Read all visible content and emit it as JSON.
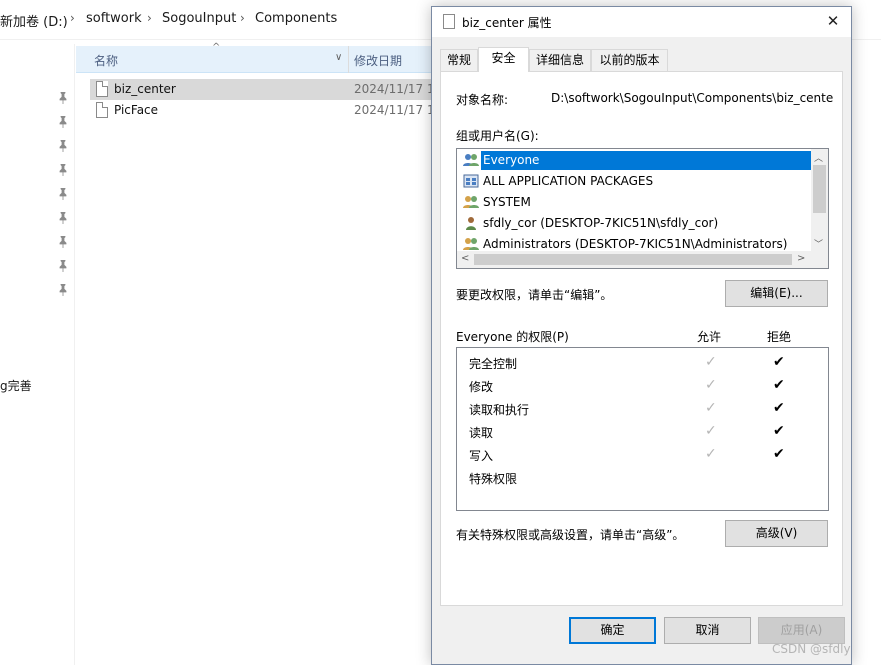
{
  "explorer": {
    "breadcrumb": [
      "新加卷 (D:)",
      "softwork",
      "SogouInput",
      "Components"
    ],
    "columns": {
      "name": "名称",
      "date": "修改日期"
    },
    "files": [
      {
        "name": "biz_center",
        "date": "2024/11/17 1",
        "selected": true
      },
      {
        "name": "PicFace",
        "date": "2024/11/17 1",
        "selected": false
      }
    ],
    "nav_partial_text": "g完善"
  },
  "dialog": {
    "title": "biz_center 属性",
    "tabs": [
      "常规",
      "安全",
      "详细信息",
      "以前的版本"
    ],
    "active_tab": "安全",
    "object_name_label": "对象名称:",
    "object_name_value": "D:\\softwork\\SogouInput\\Components\\biz_center",
    "group_label": "组或用户名(G):",
    "users": [
      {
        "name": "Everyone",
        "icon": "group-icon",
        "selected": true
      },
      {
        "name": "ALL APPLICATION PACKAGES",
        "icon": "packages-icon",
        "selected": false
      },
      {
        "name": "SYSTEM",
        "icon": "group-icon",
        "selected": false
      },
      {
        "name": "sfdly_cor (DESKTOP-7KIC51N\\sfdly_cor)",
        "icon": "user-icon",
        "selected": false
      },
      {
        "name": "Administrators (DESKTOP-7KIC51N\\Administrators)",
        "icon": "group-icon",
        "selected": false
      }
    ],
    "change_hint": "要更改权限，请单击“编辑”。",
    "edit_button": "编辑(E)...",
    "permissions_label": "Everyone 的权限(P)",
    "allow_label": "允许",
    "deny_label": "拒绝",
    "permissions": [
      {
        "name": "完全控制",
        "allow": true,
        "deny": true
      },
      {
        "name": "修改",
        "allow": true,
        "deny": true
      },
      {
        "name": "读取和执行",
        "allow": true,
        "deny": true
      },
      {
        "name": "读取",
        "allow": true,
        "deny": true
      },
      {
        "name": "写入",
        "allow": true,
        "deny": true
      },
      {
        "name": "特殊权限",
        "allow": false,
        "deny": false
      }
    ],
    "advanced_hint": "有关特殊权限或高级设置，请单击“高级”。",
    "advanced_button": "高级(V)",
    "ok_button": "确定",
    "cancel_button": "取消",
    "apply_button": "应用(A)"
  },
  "watermark": "CSDN @sfdly",
  "colors": {
    "selection": "#0078d7",
    "header_bg": "#e5f1fb",
    "dialog_bg": "#f0f0f0"
  }
}
